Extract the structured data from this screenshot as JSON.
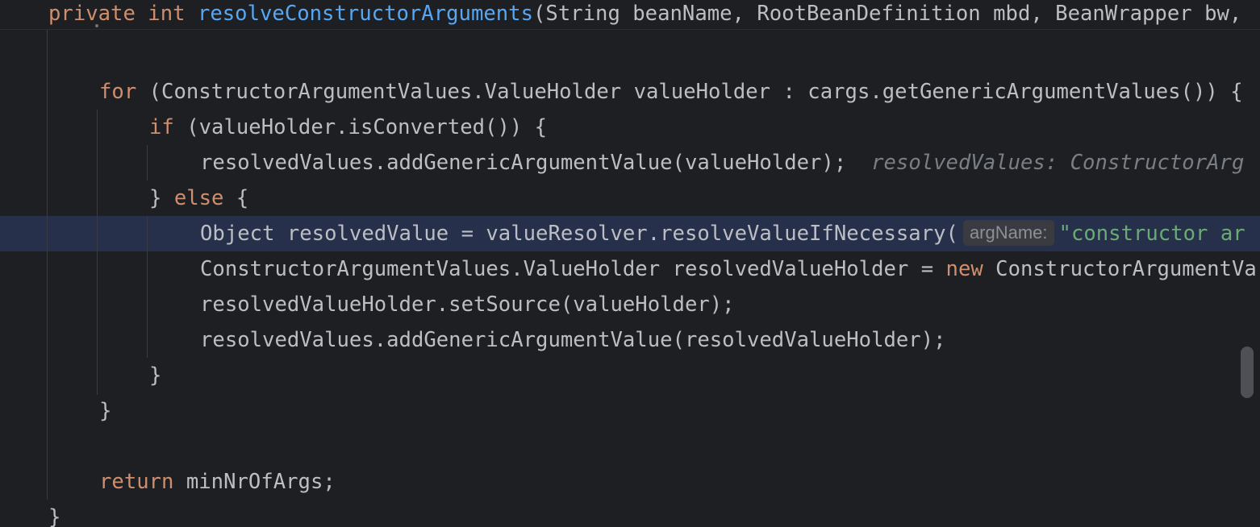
{
  "editor": {
    "sticky_signature": {
      "kw_private": "private",
      "kw_int": "int",
      "method_name": "resolveConstructorArguments",
      "params": "(String beanName, RootBeanDefinition mbd, BeanWrapper bw,"
    },
    "lines": {
      "for_line": {
        "kw": "for",
        "code": " (ConstructorArgumentValues.ValueHolder valueHolder : cargs.getGenericArgumentValues()) {"
      },
      "if_line": {
        "kw": "if",
        "code": " (valueHolder.isConverted()) {"
      },
      "add_converted": {
        "code": "resolvedValues.addGenericArgumentValue(valueHolder);",
        "inline_value": "resolvedValues: ConstructorArg"
      },
      "else_line": {
        "brace": "} ",
        "kw": "else",
        "code": " {"
      },
      "object_line": {
        "code": "Object resolvedValue = valueResolver.resolveValueIfNecessary(",
        "param_hint": "argName:",
        "string": "\"constructor ar"
      },
      "holder_line": {
        "code_a": "ConstructorArgumentValues.ValueHolder resolvedValueHolder = ",
        "kw_new": "new",
        "code_b": " ConstructorArgumentVa"
      },
      "set_source": {
        "code": "resolvedValueHolder.setSource(valueHolder);"
      },
      "add_resolved": {
        "code": "resolvedValues.addGenericArgumentValue(resolvedValueHolder);"
      },
      "close_if": {
        "code": "}"
      },
      "close_for": {
        "code": "}"
      },
      "return_line": {
        "kw": "return",
        "code": " minNrOfArgs;"
      },
      "close_method": {
        "code": "}"
      }
    }
  }
}
